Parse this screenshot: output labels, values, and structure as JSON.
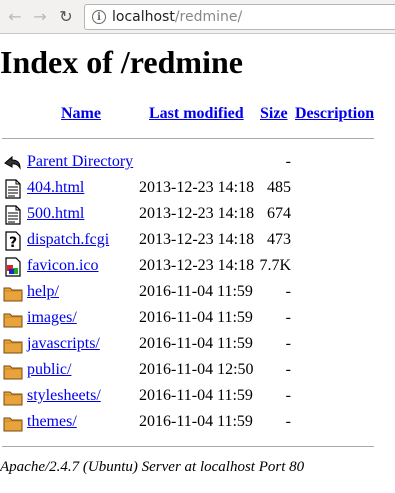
{
  "browser": {
    "url_host": "localhost",
    "url_path": "/redmine/"
  },
  "page": {
    "title": "Index of /redmine",
    "headers": {
      "name": "Name",
      "last_modified": "Last modified",
      "size": "Size",
      "description": "Description"
    },
    "rows": [
      {
        "icon": "back-icon",
        "name": "Parent Directory",
        "date": "",
        "size": "-"
      },
      {
        "icon": "text-file-icon",
        "name": "404.html",
        "date": "2013-12-23 14:18",
        "size": "485"
      },
      {
        "icon": "text-file-icon",
        "name": "500.html",
        "date": "2013-12-23 14:18",
        "size": "674"
      },
      {
        "icon": "unknown-file-icon",
        "name": "dispatch.fcgi",
        "date": "2013-12-23 14:18",
        "size": "473"
      },
      {
        "icon": "image-file-icon",
        "name": "favicon.ico",
        "date": "2013-12-23 14:18",
        "size": "7.7K"
      },
      {
        "icon": "folder-icon",
        "name": "help/",
        "date": "2016-11-04 11:59",
        "size": "-"
      },
      {
        "icon": "folder-icon",
        "name": "images/",
        "date": "2016-11-04 11:59",
        "size": "-"
      },
      {
        "icon": "folder-icon",
        "name": "javascripts/",
        "date": "2016-11-04 11:59",
        "size": "-"
      },
      {
        "icon": "folder-icon",
        "name": "public/",
        "date": "2016-11-04 12:50",
        "size": "-"
      },
      {
        "icon": "folder-icon",
        "name": "stylesheets/",
        "date": "2016-11-04 11:59",
        "size": "-"
      },
      {
        "icon": "folder-icon",
        "name": "themes/",
        "date": "2016-11-04 11:59",
        "size": "-"
      }
    ],
    "footer": "Apache/2.4.7 (Ubuntu) Server at localhost Port 80"
  },
  "colors": {
    "link": "#0000ee",
    "folder": "#e8a33d"
  }
}
